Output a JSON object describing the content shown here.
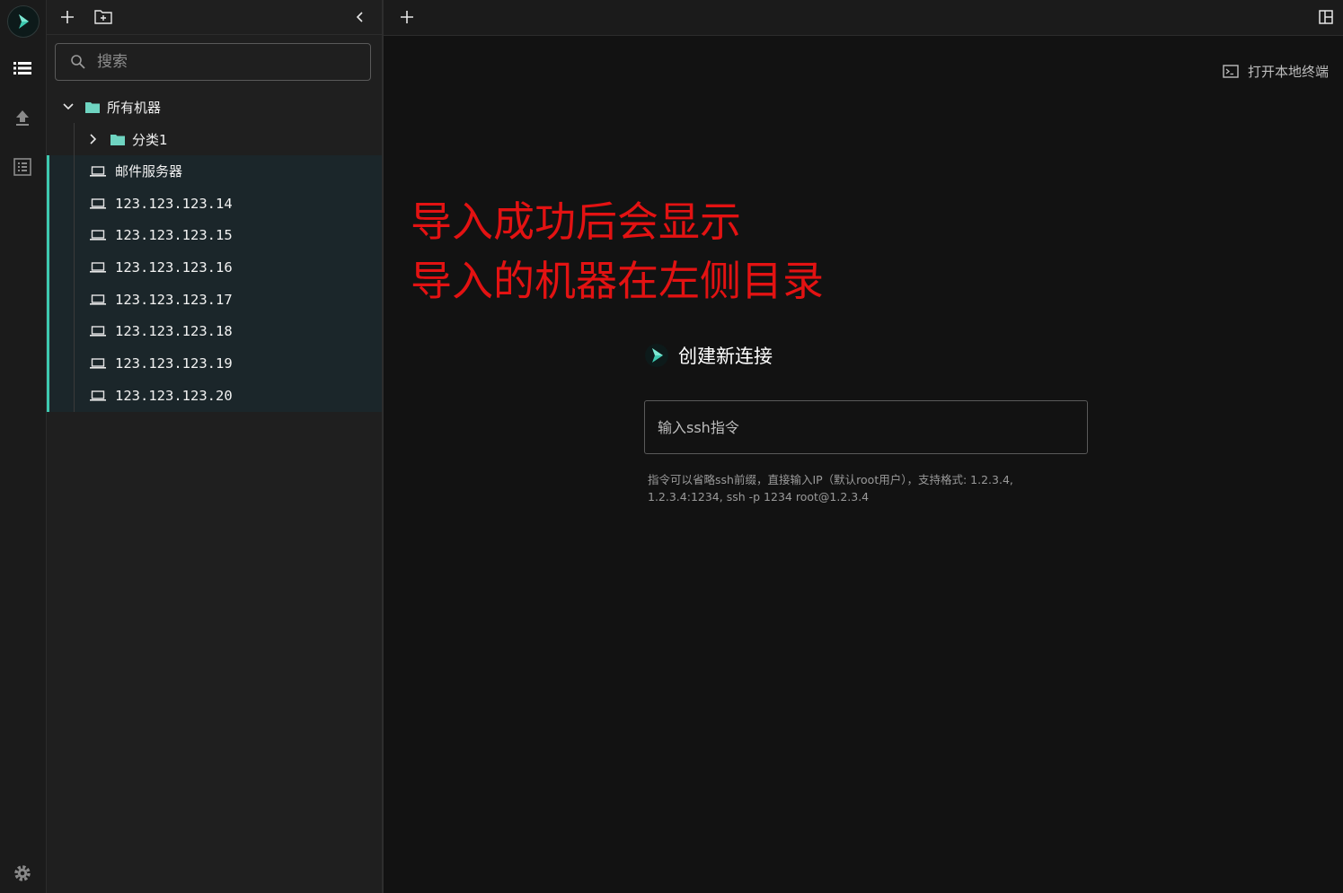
{
  "sidebar": {
    "search_placeholder": "搜索",
    "tree": {
      "root_label": "所有机器",
      "subfolder_label": "分类1",
      "hosts": [
        {
          "label": "邮件服务器",
          "mono": false
        },
        {
          "label": "123.123.123.14",
          "mono": true
        },
        {
          "label": "123.123.123.15",
          "mono": true
        },
        {
          "label": "123.123.123.16",
          "mono": true
        },
        {
          "label": "123.123.123.17",
          "mono": true
        },
        {
          "label": "123.123.123.18",
          "mono": true
        },
        {
          "label": "123.123.123.19",
          "mono": true
        },
        {
          "label": "123.123.123.20",
          "mono": true
        }
      ]
    }
  },
  "main": {
    "open_local_terminal": "打开本地终端",
    "annotation_line1": "导入成功后会显示",
    "annotation_line2": "导入的机器在左侧目录",
    "create_title": "创建新连接",
    "ssh_placeholder": "输入ssh指令",
    "hint_line1": "指令可以省略ssh前缀，直接输入IP（默认root用户），支持格式: 1.2.3.4,",
    "hint_line2": "1.2.3.4:1234, ssh -p 1234 root@1.2.3.4"
  },
  "colors": {
    "accent": "#3ec9b0",
    "annotation": "#e31212",
    "background": "#121212",
    "sidebar": "#1f1f1f"
  },
  "icons": [
    "logo-icon",
    "list-icon",
    "upload-icon",
    "log-icon",
    "settings-icon",
    "plus-icon",
    "new-folder-icon",
    "collapse-icon",
    "search-icon",
    "chevron-down-icon",
    "chevron-right-icon",
    "folder-icon",
    "laptop-icon",
    "terminal-icon",
    "split-layout-icon"
  ]
}
